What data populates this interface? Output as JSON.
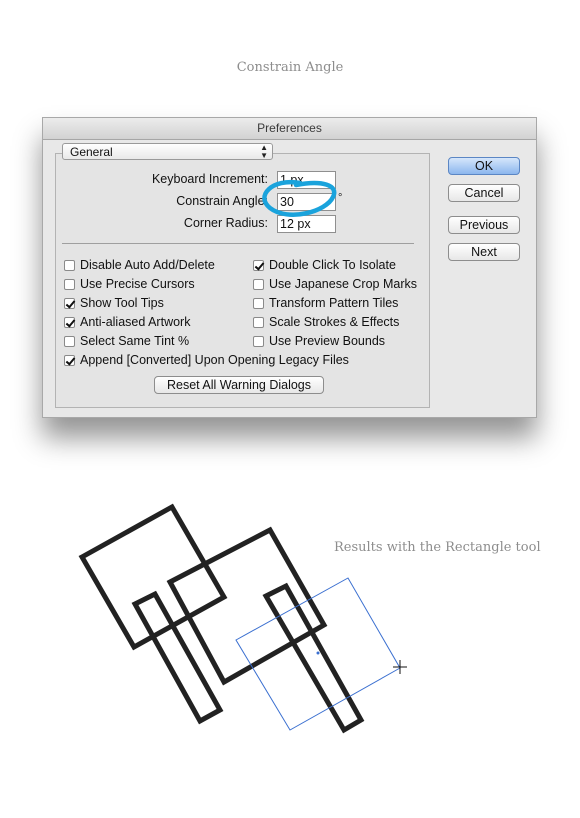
{
  "captions": {
    "top": "Constrain Angle",
    "right": "Results with the Rectangle tool"
  },
  "dialog": {
    "title": "Preferences",
    "section_popup": "General",
    "fields": [
      {
        "label": "Keyboard Increment:",
        "value": "1 px"
      },
      {
        "label": "Constrain Angle:",
        "value": "30",
        "unit": "°"
      },
      {
        "label": "Corner Radius:",
        "value": "12 px"
      }
    ],
    "checkboxes": [
      {
        "label": "Disable Auto Add/Delete",
        "checked": false
      },
      {
        "label": "Use Precise Cursors",
        "checked": false
      },
      {
        "label": "Show Tool Tips",
        "checked": true
      },
      {
        "label": "Anti-aliased Artwork",
        "checked": true
      },
      {
        "label": "Select Same Tint %",
        "checked": false
      },
      {
        "label": "Double Click To Isolate",
        "checked": true
      },
      {
        "label": "Use Japanese Crop Marks",
        "checked": false
      },
      {
        "label": "Transform Pattern Tiles",
        "checked": false
      },
      {
        "label": "Scale Strokes & Effects",
        "checked": false
      },
      {
        "label": "Use Preview Bounds",
        "checked": false
      },
      {
        "label": "Append [Converted] Upon Opening Legacy Files",
        "checked": true
      }
    ],
    "reset_button": "Reset All Warning Dialogs",
    "buttons": {
      "ok": "OK",
      "cancel": "Cancel",
      "previous": "Previous",
      "next": "Next"
    }
  },
  "colors": {
    "annotation_circle": "#1aa3dc",
    "selection_outline": "#3a6fd0",
    "ok_button": "#8cb6ee"
  }
}
